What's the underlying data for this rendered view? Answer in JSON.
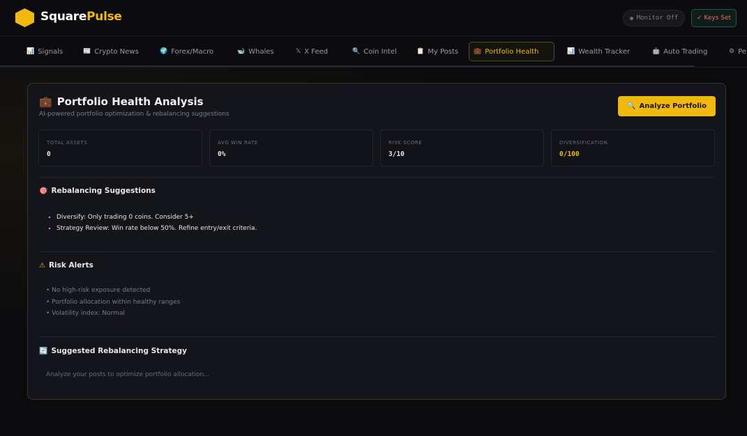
{
  "brand": {
    "name_part1": "Square",
    "name_part2": "Pulse"
  },
  "header": {
    "monitor_label": "Monitor Off",
    "keys_label": "✓ Keys Set"
  },
  "nav": {
    "items": [
      {
        "icon": "📊",
        "label": "Signals"
      },
      {
        "icon": "📰",
        "label": "Crypto News"
      },
      {
        "icon": "🌍",
        "label": "Forex/Macro"
      },
      {
        "icon": "🐋",
        "label": "Whales"
      },
      {
        "icon": "𝕏",
        "label": "X Feed"
      },
      {
        "icon": "🔍",
        "label": "Coin Intel"
      },
      {
        "icon": "📋",
        "label": "My Posts"
      },
      {
        "icon": "💼",
        "label": "Portfolio Health"
      },
      {
        "icon": "📊",
        "label": "Wealth Tracker"
      },
      {
        "icon": "🤖",
        "label": "Auto Trading"
      },
      {
        "icon": "⚙",
        "label": "Pe"
      }
    ],
    "active_index": 7
  },
  "card": {
    "title_icon": "💼",
    "title": "Portfolio Health Analysis",
    "subtitle": "AI-powered portfolio optimization & rebalancing suggestions",
    "analyze_button": {
      "icon": "🔍",
      "label": "Analyze Portfolio"
    }
  },
  "stats": [
    {
      "label": "TOTAL ASSETS",
      "value": "0"
    },
    {
      "label": "AVG WIN RATE",
      "value": "0%"
    },
    {
      "label": "RISK SCORE",
      "value": "3/10"
    },
    {
      "label": "DIVERSIFICATION",
      "value": "0/100"
    }
  ],
  "rebalancing": {
    "icon": "🎯",
    "title": "Rebalancing Suggestions",
    "items": [
      {
        "bold": "Diversify:",
        "text": " Only trading 0 coins. Consider 5+"
      },
      {
        "bold": "Strategy Review:",
        "text": " Win rate below 50%. Refine entry/exit criteria."
      }
    ]
  },
  "risk_alerts": {
    "icon": "⚠",
    "title": "Risk Alerts",
    "items": [
      "• No high-risk exposure detected",
      "• Portfolio allocation within healthy ranges",
      "• Volatility index: Normal"
    ]
  },
  "strategy": {
    "icon": "🔄",
    "title": "Suggested Rebalancing Strategy",
    "placeholder": "Analyze your posts to optimize portfolio allocation..."
  },
  "colors": {
    "accent": "#f0b90b",
    "background": "#0b0b0e",
    "card": "#14151b"
  }
}
